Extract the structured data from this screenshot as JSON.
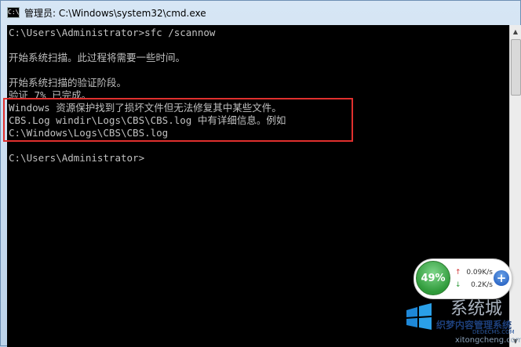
{
  "window": {
    "title": "管理员: C:\\Windows\\system32\\cmd.exe",
    "icon_label": "C:\\"
  },
  "console": {
    "lines": [
      "C:\\Users\\Administrator>sfc /scannow",
      "开始系统扫描。此过程将需要一些时间。",
      "开始系统扫描的验证阶段。",
      "验证 7% 已完成。",
      "Windows 资源保护找到了损坏文件但无法修复其中某些文件。",
      "CBS.Log windir\\Logs\\CBS\\CBS.log 中有详细信息。例如",
      "C:\\Windows\\Logs\\CBS\\CBS.log",
      "C:\\Users\\Administrator>"
    ],
    "text_color": "#c0c0c0",
    "background_color": "#000000"
  },
  "highlight_color": "#e0302e",
  "net_widget": {
    "memory_percent": "49%",
    "upload_speed": "0.09K/s",
    "download_speed": "0.2K/s",
    "upload_icon": "arrow-up-icon",
    "download_icon": "arrow-down-icon",
    "add_icon": "plus-icon",
    "up_arrow": "↑",
    "down_arrow": "↓",
    "plus": "+"
  },
  "watermark": {
    "title": "系统城",
    "subtitle": "织梦内容管理系统",
    "domain": "DEDECMS.COM",
    "url": "xitongcheng.com"
  }
}
